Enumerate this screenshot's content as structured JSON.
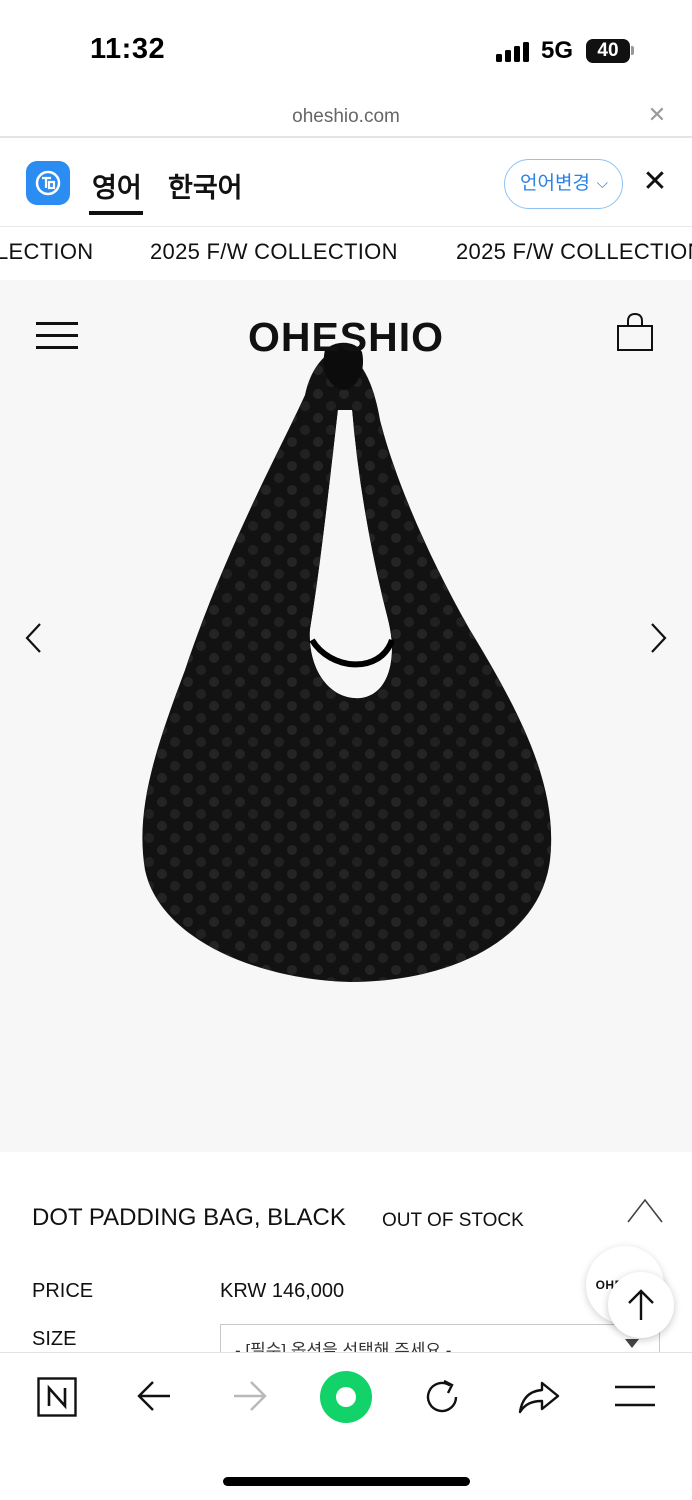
{
  "status_bar": {
    "time": "11:32",
    "network": "5G",
    "battery": "40"
  },
  "url_bar": {
    "url": "oheshio.com",
    "close_icon": "close-icon"
  },
  "translate_bar": {
    "tab_active": "영어",
    "tab_inactive": "한국어",
    "change_language": "언어변경",
    "accent_color": "#2b8cf2"
  },
  "marquee": {
    "items": [
      "LECTION",
      "2025 F/W COLLECTION",
      "2025 F/W COLLECTION"
    ]
  },
  "header": {
    "brand": "OHESHIO",
    "menu_icon": "hamburger-icon",
    "cart_icon": "shopping-bag-icon"
  },
  "gallery": {
    "prev_icon": "chevron-left-icon",
    "next_icon": "chevron-right-icon",
    "image": "black dotted hobo bag"
  },
  "product": {
    "title": "DOT PADDING BAG, BLACK",
    "stock_status": "OUT OF STOCK",
    "price_label": "PRICE",
    "price_value": "KRW 146,000",
    "size_label": "SIZE",
    "size_placeholder": "- [필수] 옵션을 선택해 주세요 -",
    "floating_logo": "OHESHIO"
  },
  "toolbar": {
    "items": [
      "naver-icon",
      "back-arrow-icon",
      "forward-arrow-icon",
      "green-dot-icon",
      "reload-icon",
      "share-icon",
      "menu-icon"
    ]
  }
}
